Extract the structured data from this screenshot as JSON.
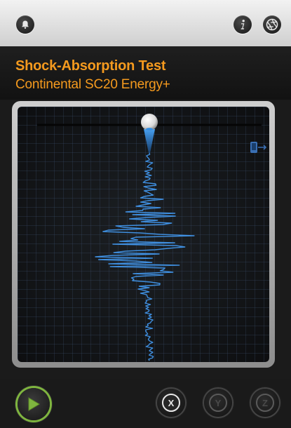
{
  "app": {
    "title": "Shock-Absorption Test",
    "subtitle": "Continental SC20 Energy+"
  },
  "toolbar": {
    "left_icon": "bell-icon",
    "info_icon": "info-icon",
    "aperture_icon": "aperture-icon"
  },
  "graph": {
    "trace_color": "#3f8fe0",
    "ball_color": "#f2f2f2",
    "export_icon": "export-icon"
  },
  "controls": {
    "play_icon": "play-icon",
    "axis_x_label": "X",
    "axis_y_label": "Y",
    "axis_z_label": "Z",
    "active_axis": "X",
    "accent_color": "#7fb53f"
  }
}
